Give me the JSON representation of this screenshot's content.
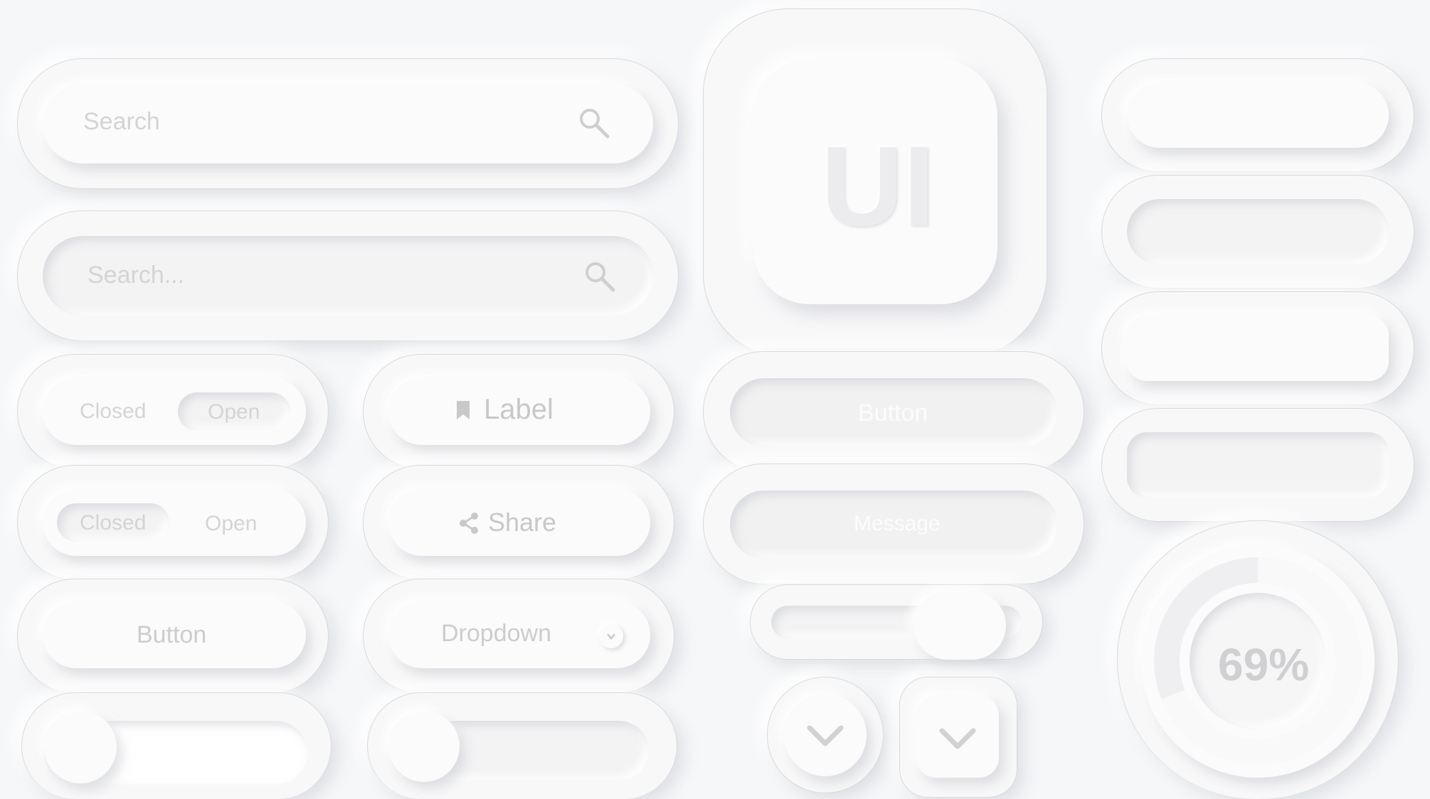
{
  "search1": {
    "placeholder": "Search"
  },
  "search2": {
    "placeholder": "Search..."
  },
  "toggle1": {
    "left": "Closed",
    "right": "Open",
    "active": "right"
  },
  "toggle2": {
    "left": "Closed",
    "right": "Open",
    "active": "left"
  },
  "buttons": {
    "button_label": "Button",
    "label_label": "Label",
    "share_label": "Share",
    "dropdown_label": "Dropdown",
    "center_button_label": "Button",
    "message_label": "Message"
  },
  "logo_tile": {
    "text": "UI"
  },
  "progress": {
    "value_text": "69%",
    "value": 0.69
  },
  "icons": {
    "search": "search-icon",
    "bookmark": "bookmark-icon",
    "share": "share-icon",
    "dropdown": "chevron-down-icon",
    "chevron": "chevron-down-icon"
  },
  "colors": {
    "background": "#f6f7f9",
    "text": "#d4d4d6",
    "border": "#d9dadd"
  }
}
